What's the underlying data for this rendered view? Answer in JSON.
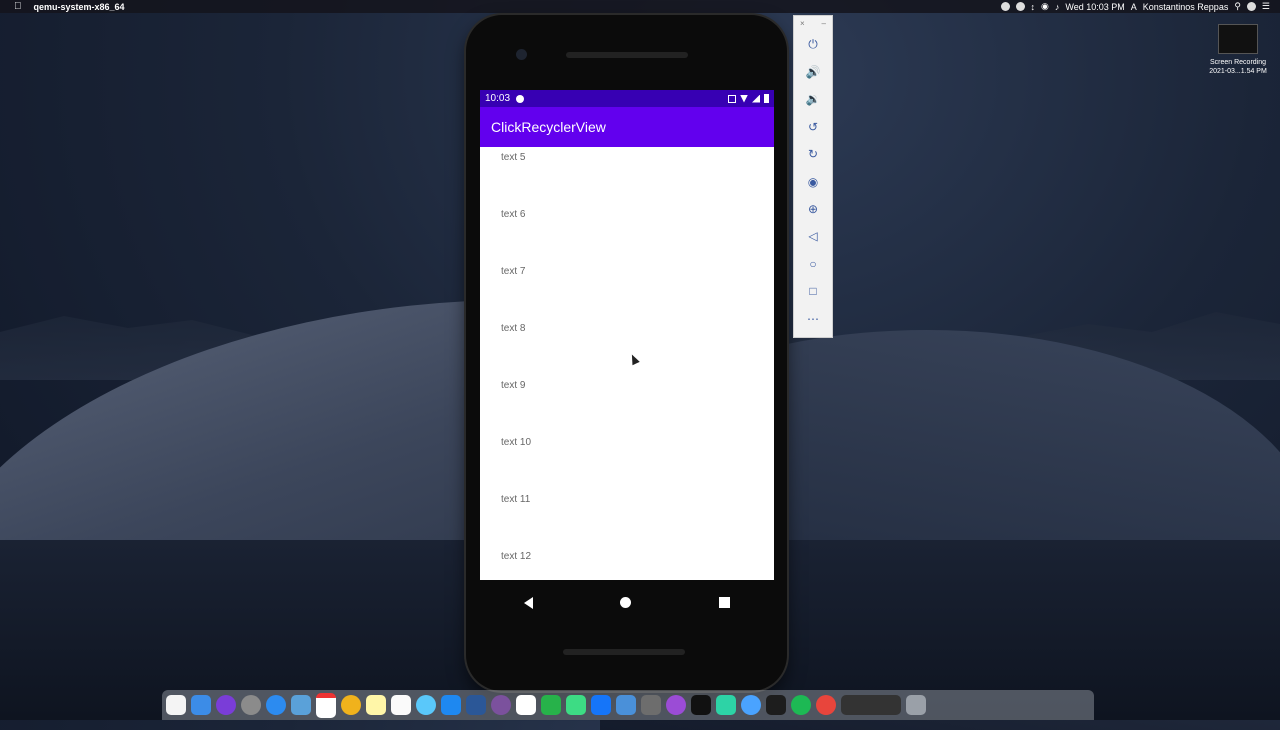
{
  "menubar": {
    "app_name": "qemu-system-x86_64",
    "datetime": "Wed 10:03 PM",
    "user": "Konstantinos Reppas",
    "input_source": "A"
  },
  "desktop": {
    "recording": {
      "title": "Screen Recording",
      "subtitle": "2021-03...1.54 PM"
    }
  },
  "phone": {
    "status": {
      "time": "10:03"
    },
    "app_title": "ClickRecyclerView",
    "items": [
      "text 5",
      "text 6",
      "text 7",
      "text 8",
      "text 9",
      "text 10",
      "text 11",
      "text 12"
    ]
  },
  "emulator_toolbar": {
    "buttons": [
      "power-icon",
      "volume-up-icon",
      "volume-down-icon",
      "rotate-left-icon",
      "rotate-right-icon",
      "camera-icon",
      "zoom-icon",
      "back-icon",
      "home-icon",
      "overview-icon",
      "more-icon"
    ]
  },
  "dock": {
    "apps": [
      "finder",
      "launchpad",
      "siri",
      "rocket",
      "safari",
      "preview",
      "calendar",
      "chrome-canary",
      "notes",
      "reminders",
      "messages",
      "app-store",
      "word",
      "viber",
      "slack",
      "numbers",
      "android-studio",
      "xcode",
      "simulator",
      "activity-monitor",
      "podcasts",
      "apple-tv",
      "star",
      "maps",
      "terminal",
      "spotify",
      "chrome",
      "screenshots",
      "trash"
    ]
  }
}
